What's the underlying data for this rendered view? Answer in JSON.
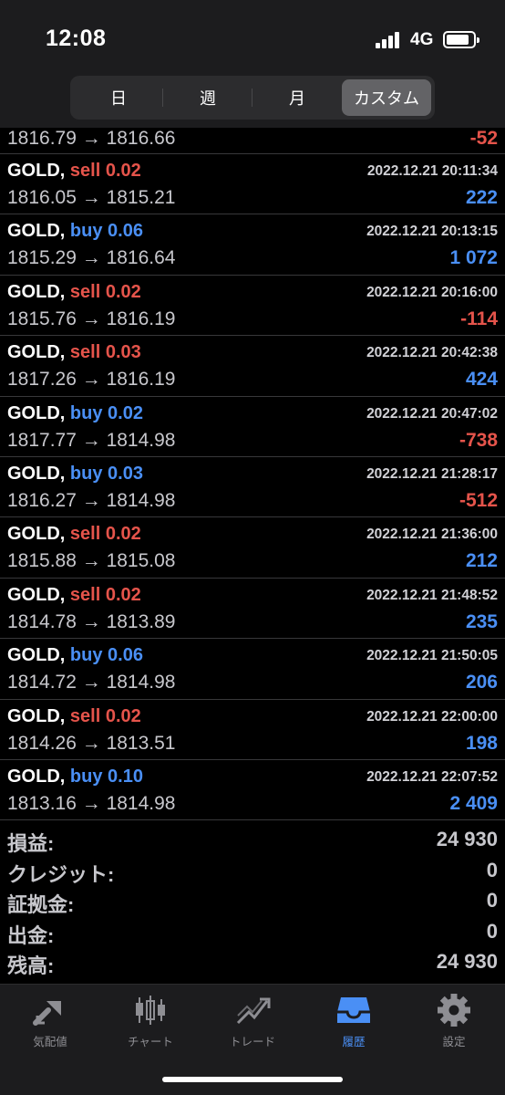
{
  "status_bar": {
    "time": "12:08",
    "network": "4G"
  },
  "period_tabs": [
    {
      "label": "日",
      "active": false
    },
    {
      "label": "週",
      "active": false
    },
    {
      "label": "月",
      "active": false
    },
    {
      "label": "カスタム",
      "active": true
    }
  ],
  "partial_trade": {
    "prices": "1816.79 → 1816.66",
    "profit": "-52"
  },
  "trades": [
    {
      "symbol": "GOLD,",
      "side": "sell",
      "volume": "sell 0.02",
      "time": "2022.12.21 20:11:34",
      "prices": "1816.05 → 1815.21",
      "profit": "222"
    },
    {
      "symbol": "GOLD,",
      "side": "buy",
      "volume": "buy 0.06",
      "time": "2022.12.21 20:13:15",
      "prices": "1815.29 → 1816.64",
      "profit": "1 072"
    },
    {
      "symbol": "GOLD,",
      "side": "sell",
      "volume": "sell 0.02",
      "time": "2022.12.21 20:16:00",
      "prices": "1815.76 → 1816.19",
      "profit": "-114"
    },
    {
      "symbol": "GOLD,",
      "side": "sell",
      "volume": "sell 0.03",
      "time": "2022.12.21 20:42:38",
      "prices": "1817.26 → 1816.19",
      "profit": "424"
    },
    {
      "symbol": "GOLD,",
      "side": "buy",
      "volume": "buy 0.02",
      "time": "2022.12.21 20:47:02",
      "prices": "1817.77 → 1814.98",
      "profit": "-738"
    },
    {
      "symbol": "GOLD,",
      "side": "buy",
      "volume": "buy 0.03",
      "time": "2022.12.21 21:28:17",
      "prices": "1816.27 → 1814.98",
      "profit": "-512"
    },
    {
      "symbol": "GOLD,",
      "side": "sell",
      "volume": "sell 0.02",
      "time": "2022.12.21 21:36:00",
      "prices": "1815.88 → 1815.08",
      "profit": "212"
    },
    {
      "symbol": "GOLD,",
      "side": "sell",
      "volume": "sell 0.02",
      "time": "2022.12.21 21:48:52",
      "prices": "1814.78 → 1813.89",
      "profit": "235"
    },
    {
      "symbol": "GOLD,",
      "side": "buy",
      "volume": "buy 0.06",
      "time": "2022.12.21 21:50:05",
      "prices": "1814.72 → 1814.98",
      "profit": "206"
    },
    {
      "symbol": "GOLD,",
      "side": "sell",
      "volume": "sell 0.02",
      "time": "2022.12.21 22:00:00",
      "prices": "1814.26 → 1813.51",
      "profit": "198"
    },
    {
      "symbol": "GOLD,",
      "side": "buy",
      "volume": "buy 0.10",
      "time": "2022.12.21 22:07:52",
      "prices": "1813.16 → 1814.98",
      "profit": "2 409"
    }
  ],
  "summary": [
    {
      "label": "損益:",
      "value": "24 930"
    },
    {
      "label": "クレジット:",
      "value": "0"
    },
    {
      "label": "証拠金:",
      "value": "0"
    },
    {
      "label": "出金:",
      "value": "0"
    },
    {
      "label": "残高:",
      "value": "24 930"
    }
  ],
  "tabbar": [
    {
      "label": "気配値",
      "icon": "quotes-icon",
      "active": false
    },
    {
      "label": "チャート",
      "icon": "chart-icon",
      "active": false
    },
    {
      "label": "トレード",
      "icon": "trade-icon",
      "active": false
    },
    {
      "label": "履歴",
      "icon": "history-icon",
      "active": true
    },
    {
      "label": "設定",
      "icon": "settings-icon",
      "active": false
    }
  ],
  "colors": {
    "sell": "#e5544b",
    "buy": "#4a8ff5",
    "active_tab": "#4a8ff5",
    "inactive_tab": "#8e8e93"
  }
}
